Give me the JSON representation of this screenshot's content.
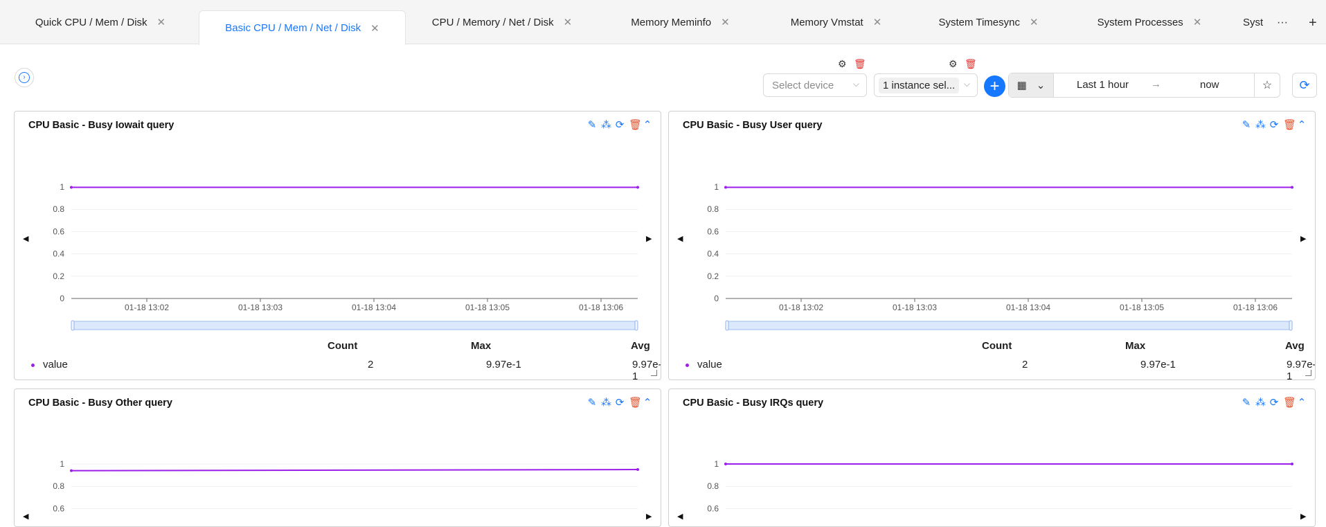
{
  "tabs": [
    {
      "label": "Quick CPU / Mem / Disk",
      "active": false
    },
    {
      "label": "Basic CPU / Mem / Net / Disk",
      "active": true
    },
    {
      "label": "CPU / Memory / Net / Disk",
      "active": false
    },
    {
      "label": "Memory Meminfo",
      "active": false
    },
    {
      "label": "Memory Vmstat",
      "active": false
    },
    {
      "label": "System Timesync",
      "active": false
    },
    {
      "label": "System Processes",
      "active": false
    },
    {
      "label": "Syst",
      "active": false
    }
  ],
  "tab_more_label": "···",
  "tab_add_label": "+",
  "toolbar": {
    "device_placeholder": "Select device",
    "instance_value": "1 instance sel...",
    "time_from": "Last 1 hour",
    "time_arrow": "→",
    "time_to": "now"
  },
  "colors": {
    "accent": "#1677ff",
    "series": "#9b1fe8",
    "danger": "#e5322d"
  },
  "icons": [
    "settings-icon",
    "trash-icon",
    "plus-icon",
    "calendar-icon",
    "chevron-down-icon",
    "star-icon",
    "refresh-icon",
    "edit-icon",
    "share-icon",
    "sync-icon",
    "collapse-up-icon"
  ],
  "stats_headers": {
    "count": "Count",
    "max": "Max",
    "avg": "Avg"
  },
  "panels": [
    {
      "title": "CPU Basic - Busy Iowait query",
      "legend": "value",
      "count": "2",
      "max": "9.97e-1",
      "avg": "9.97e-1"
    },
    {
      "title": "CPU Basic - Busy User query",
      "legend": "value",
      "count": "2",
      "max": "9.97e-1",
      "avg": "9.97e-1"
    },
    {
      "title": "CPU Basic - Busy Other query"
    },
    {
      "title": "CPU Basic - Busy IRQs query"
    }
  ],
  "chart_data": [
    {
      "type": "line",
      "title": "CPU Basic - Busy Iowait query",
      "x_ticks": [
        "01-18 13:02",
        "01-18 13:03",
        "01-18 13:04",
        "01-18 13:05",
        "01-18 13:06"
      ],
      "y_ticks": [
        "0",
        "0.2",
        "0.4",
        "0.6",
        "0.8",
        "1"
      ],
      "ylim": [
        0,
        1
      ],
      "series": [
        {
          "name": "value",
          "values": [
            0.997,
            0.997
          ]
        }
      ]
    },
    {
      "type": "line",
      "title": "CPU Basic - Busy User query",
      "x_ticks": [
        "01-18 13:02",
        "01-18 13:03",
        "01-18 13:04",
        "01-18 13:05",
        "01-18 13:06"
      ],
      "y_ticks": [
        "0",
        "0.2",
        "0.4",
        "0.6",
        "0.8",
        "1"
      ],
      "ylim": [
        0,
        1
      ],
      "series": [
        {
          "name": "value",
          "values": [
            0.997,
            0.997
          ]
        }
      ]
    },
    {
      "type": "line",
      "title": "CPU Basic - Busy Other query",
      "y_ticks": [
        "0.6",
        "0.8",
        "1"
      ],
      "ylim": [
        0,
        1
      ],
      "series": [
        {
          "name": "value",
          "values": [
            0.94,
            0.95
          ]
        }
      ]
    },
    {
      "type": "line",
      "title": "CPU Basic - Busy IRQs query",
      "y_ticks": [
        "0.6",
        "0.8",
        "1"
      ],
      "ylim": [
        0,
        1
      ],
      "series": [
        {
          "name": "value",
          "values": [
            1.0,
            1.0
          ]
        }
      ]
    }
  ]
}
